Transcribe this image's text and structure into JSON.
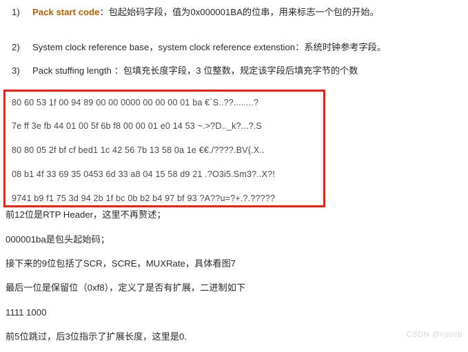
{
  "list": {
    "items": [
      {
        "marker": "1)",
        "term": "Pack start code",
        "rest": "：包起始码字段，值为0x000001BA的位串，用来标志一个包的开始。"
      },
      {
        "marker": "2)",
        "term": "",
        "rest": "System clock reference base，system clock reference extenstion：系统时钟参考字段。"
      },
      {
        "marker": "3)",
        "term": "",
        "rest": "Pack stuffing length ：包填充长度字段，3 位整数，规定该字段后填充字节的个数"
      }
    ]
  },
  "hex_block": {
    "border_color": "#fb1e10",
    "lines": [
      "80 60 53 1f 00 94 89 00 00 0000 00 00 00 01 ba €`S..??........?",
      "7e ff 3e fb 44 01 00 5f 6b f8 00 00 01 e0 14 53 ~.>?D.._k?...?.S",
      "80 80 05 2f bf cf bed1 1c 42 56 7b 13 58 0a 1e €€./????.BV{.X..",
      "08 b1 4f 33 69 35 0453 6d 33 a8 04 15 58 d9 21 .?O3i5.Sm3?..X?!",
      "9741 b9 f1 75 3d 94 2b 1f bc 0b b2 b4 97 bf 93 ?A??u=?+.?.?????"
    ]
  },
  "paragraphs": [
    "前12位是RTP Header，这里不再赘述；",
    "000001ba是包头起始码；",
    "接下来的9位包括了SCR，SCRE，MUXRate，具体看图7",
    "最后一位是保留位（0xf8），定义了是否有扩展，二进制如下",
    "1111 1000",
    "前5位跳过，后3位指示了扩展长度，这里是0."
  ],
  "watermark": {
    "text": "CSDN @rjszcb"
  }
}
